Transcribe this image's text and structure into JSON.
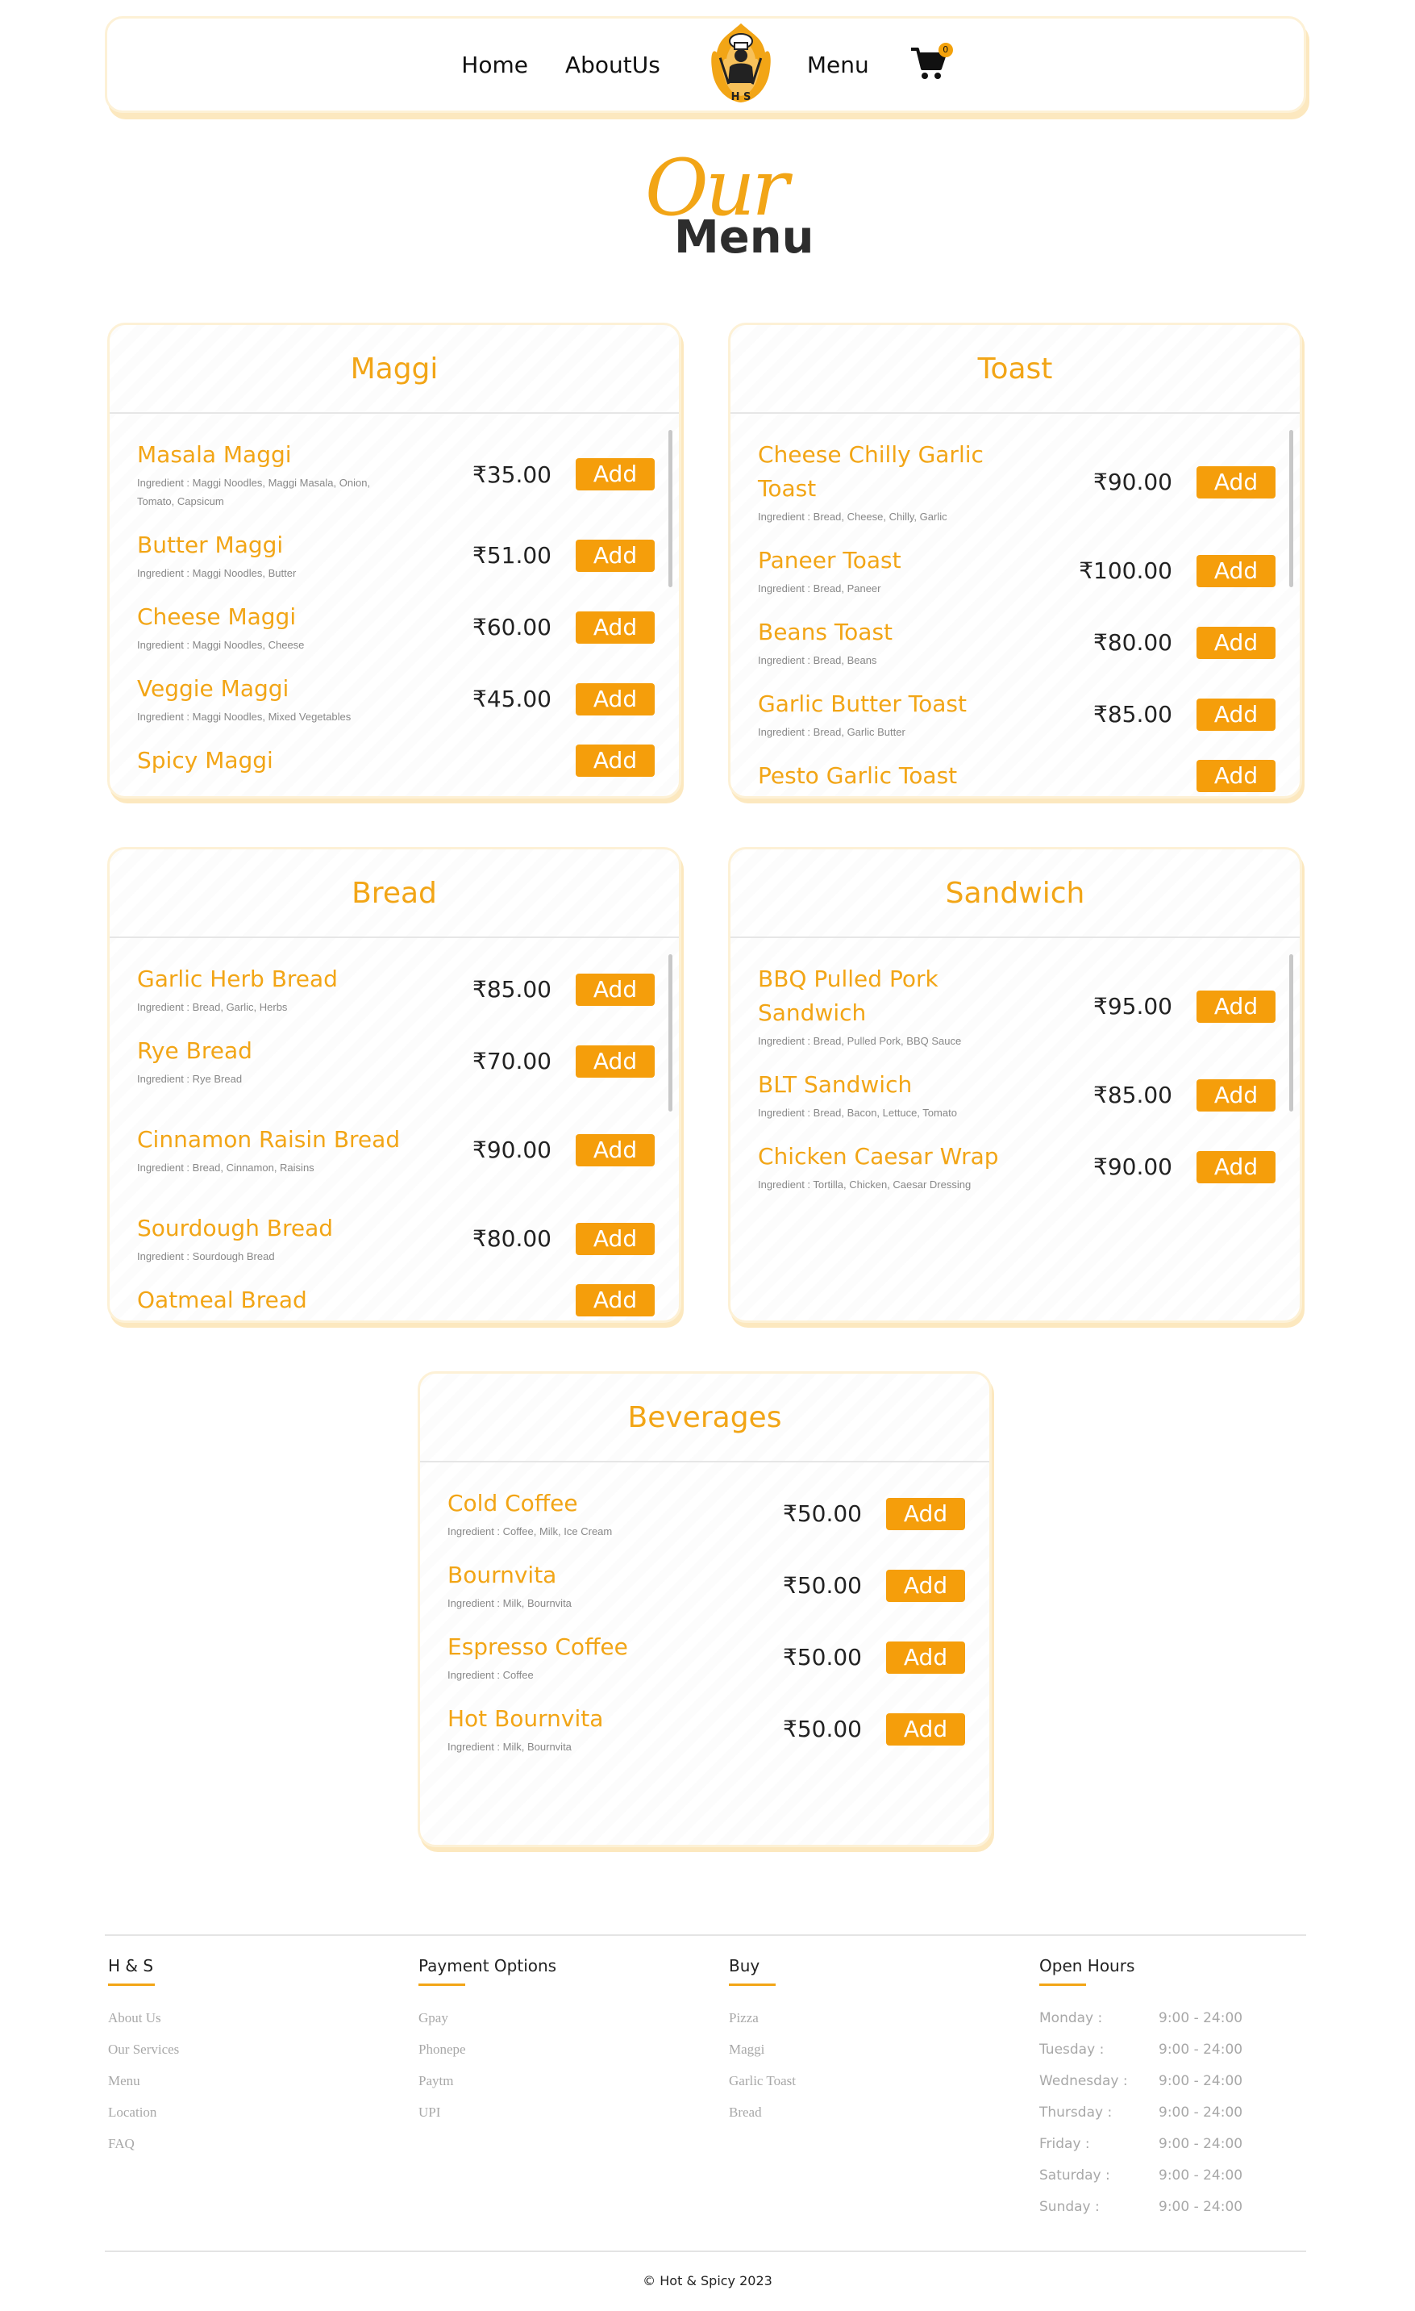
{
  "nav": {
    "home": "Home",
    "about": "AboutUs",
    "menu": "Menu",
    "cart_count": "0",
    "logo_letters": "H S"
  },
  "title": {
    "our": "Our",
    "menu": "Menu"
  },
  "colors": {
    "accent": "#f2a516",
    "button": "#f59e0b",
    "card_border": "#fdf1d6"
  },
  "add_label": "Add",
  "sections": [
    {
      "title": "Maggi",
      "items": [
        {
          "name": "Masala Maggi",
          "ingredient": "Ingredient : Maggi Noodles, Maggi Masala, Onion, Tomato, Capsicum",
          "price": "₹35.00"
        },
        {
          "name": "Butter Maggi",
          "ingredient": "Ingredient : Maggi Noodles, Butter",
          "price": "₹51.00"
        },
        {
          "name": "Cheese Maggi",
          "ingredient": "Ingredient : Maggi Noodles, Cheese",
          "price": "₹60.00"
        },
        {
          "name": "Veggie Maggi",
          "ingredient": "Ingredient : Maggi Noodles, Mixed Vegetables",
          "price": "₹45.00"
        },
        {
          "name": "Spicy Maggi",
          "ingredient": "",
          "price": ""
        }
      ]
    },
    {
      "title": "Toast",
      "items": [
        {
          "name": "Cheese Chilly Garlic Toast",
          "ingredient": "Ingredient : Bread, Cheese, Chilly, Garlic",
          "price": "₹90.00"
        },
        {
          "name": "Paneer Toast",
          "ingredient": "Ingredient : Bread, Paneer",
          "price": "₹100.00"
        },
        {
          "name": "Beans Toast",
          "ingredient": "Ingredient : Bread, Beans",
          "price": "₹80.00"
        },
        {
          "name": "Garlic Butter Toast",
          "ingredient": "Ingredient : Bread, Garlic Butter",
          "price": "₹85.00"
        },
        {
          "name": "Pesto Garlic Toast",
          "ingredient": "",
          "price": ""
        }
      ]
    },
    {
      "title": "Bread",
      "items": [
        {
          "name": "Garlic Herb Bread",
          "ingredient": "Ingredient : Bread, Garlic, Herbs",
          "price": "₹85.00"
        },
        {
          "name": "Rye Bread",
          "ingredient": "Ingredient : Rye Bread",
          "price": "₹70.00"
        },
        {
          "name": "Cinnamon Raisin Bread",
          "ingredient": "Ingredient : Bread, Cinnamon, Raisins",
          "price": "₹90.00"
        },
        {
          "name": "Sourdough Bread",
          "ingredient": "Ingredient : Sourdough Bread",
          "price": "₹80.00"
        },
        {
          "name": "Oatmeal Bread",
          "ingredient": "",
          "price": ""
        }
      ]
    },
    {
      "title": "Sandwich",
      "items": [
        {
          "name": "BBQ Pulled Pork Sandwich",
          "ingredient": "Ingredient : Bread, Pulled Pork, BBQ Sauce",
          "price": "₹95.00"
        },
        {
          "name": "BLT Sandwich",
          "ingredient": "Ingredient : Bread, Bacon, Lettuce, Tomato",
          "price": "₹85.00"
        },
        {
          "name": "Chicken Caesar Wrap",
          "ingredient": "Ingredient : Tortilla, Chicken, Caesar Dressing",
          "price": "₹90.00"
        }
      ]
    },
    {
      "title": "Beverages",
      "items": [
        {
          "name": "Cold Coffee",
          "ingredient": "Ingredient : Coffee, Milk, Ice Cream",
          "price": "₹50.00"
        },
        {
          "name": "Bournvita",
          "ingredient": "Ingredient : Milk, Bournvita",
          "price": "₹50.00"
        },
        {
          "name": "Espresso Coffee",
          "ingredient": "Ingredient : Coffee",
          "price": "₹50.00"
        },
        {
          "name": "Hot Bournvita",
          "ingredient": "Ingredient : Milk, Bournvita",
          "price": "₹50.00"
        }
      ]
    }
  ],
  "footer": {
    "columns": [
      {
        "heading": "H & S",
        "links": [
          "About Us",
          "Our Services",
          "Menu",
          "Location",
          "FAQ"
        ]
      },
      {
        "heading": "Payment Options",
        "links": [
          "Gpay",
          "Phonepe",
          "Paytm",
          "UPI"
        ]
      },
      {
        "heading": "Buy",
        "links": [
          "Pizza",
          "Maggi",
          "Garlic Toast",
          "Bread"
        ]
      }
    ],
    "hours": {
      "heading": "Open Hours",
      "rows": [
        {
          "day": "Monday :",
          "time": "9:00 - 24:00"
        },
        {
          "day": "Tuesday :",
          "time": "9:00 - 24:00"
        },
        {
          "day": "Wednesday :",
          "time": "9:00 - 24:00"
        },
        {
          "day": "Thursday :",
          "time": "9:00 - 24:00"
        },
        {
          "day": "Friday :",
          "time": "9:00 - 24:00"
        },
        {
          "day": "Saturday :",
          "time": "9:00 - 24:00"
        },
        {
          "day": "Sunday :",
          "time": "9:00 - 24:00"
        }
      ]
    },
    "copyright": "© Hot & Spicy 2023"
  }
}
